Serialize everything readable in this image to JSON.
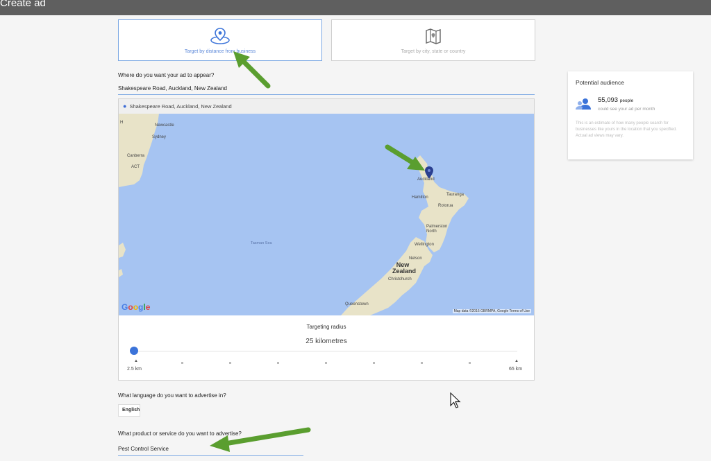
{
  "window": {
    "title": "Create ad"
  },
  "targeting_options": [
    {
      "label": "Target by distance from business",
      "icon": "map-pin-icon",
      "selected": true
    },
    {
      "label": "Target by city, state or country",
      "icon": "folded-map-icon",
      "selected": false
    }
  ],
  "location": {
    "question": "Where do you want your ad to appear?",
    "value": "Shakespeare Road, Auckland, New Zealand",
    "map_header": "Shakespeare Road, Auckland, New Zealand"
  },
  "map": {
    "labels": {
      "newcastle": "Newcastle",
      "sydney": "Sydney",
      "canberra": "Canberra",
      "act": "ACT",
      "auckland": "Auckland",
      "tauranga": "Tauranga",
      "hamilton": "Hamilton",
      "rotorua": "Rotorua",
      "palmerston_north": "Palmerston North",
      "wellington": "Wellington",
      "nelson": "Nelson",
      "new_zealand": "New Zealand",
      "christchurch": "Christchurch",
      "queenstown": "Queenstown",
      "tasman_sea": "Tasman Sea",
      "h": "H"
    },
    "logo": "Google",
    "footer": "Map data ©2016 GBRMPA, Google    Terms of Use",
    "land_color": "#e8e3c8",
    "water_color": "#a6c4f2"
  },
  "radius": {
    "title": "Targeting radius",
    "value": "25 kilometres",
    "min_label": "2.5 km",
    "max_label": "65 km",
    "fraction": 0.0
  },
  "language": {
    "question": "What language do you want to advertise in?",
    "value": "English"
  },
  "product": {
    "question": "What product or service do you want to advertise?",
    "value": "Pest Control Service"
  },
  "audience": {
    "title": "Potential audience",
    "count": "55,093",
    "unit": "people",
    "subtitle": "could see your ad per month",
    "description": "This is an estimate of how many people search for businesses like yours in the location that you specified. Actual ad views may vary."
  },
  "colors": {
    "accent": "#3b73d9",
    "arrow": "#5a9e2f",
    "topbar": "#5f5f5f"
  }
}
